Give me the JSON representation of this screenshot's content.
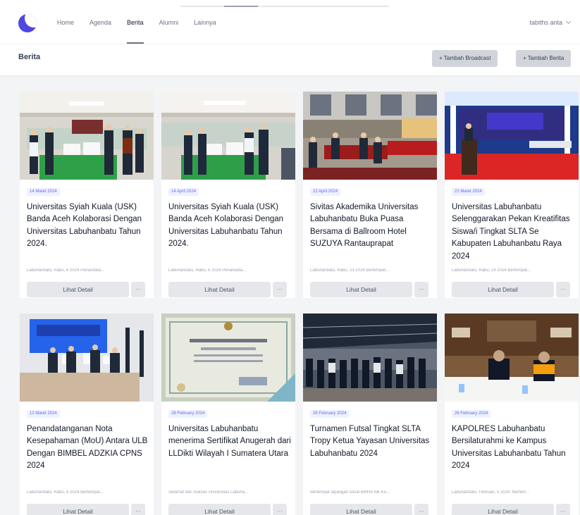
{
  "nav": {
    "items": [
      {
        "label": "Home",
        "active": false
      },
      {
        "label": "Agenda",
        "active": false
      },
      {
        "label": "Berita",
        "active": true
      },
      {
        "label": "Alumni",
        "active": false
      },
      {
        "label": "Lainnya",
        "active": false
      }
    ],
    "user": "tabiths anta"
  },
  "header": {
    "title": "Berita",
    "buttons": [
      "+ Tambah Broadcast",
      "+ Tambah Berita"
    ]
  },
  "colors": {
    "accent": "#4f46e5",
    "date_badge_bg": "#eef2ff",
    "date_badge_text": "#6366f1"
  },
  "cards": [
    {
      "date": "14 Maret 2024",
      "title": "Universitas Syiah Kuala (USK) Banda Aceh Kolaborasi Dengan Universitas Labuhanbatu Tahun 2024.",
      "excerpt": "Labuhanbatu, Rabu, 6 2024 Penandata...",
      "detail_label": "Lihat Detail",
      "more_label": "···"
    },
    {
      "date": "14 April 2024",
      "title": "Universitas Syiah Kuala (USK) Banda Aceh Kolaborasi Dengan Universitas Labuhanbatu Tahun 2024.",
      "excerpt": "Labuhanbatu, Rabu, 6 2024 Penandata...",
      "detail_label": "Lihat Detail",
      "more_label": "···"
    },
    {
      "date": "22 April 2024",
      "title": "Sivitas Akademika Universitas Labuhanbatu Buka Puasa Bersama di Ballroom Hotel SUZUYA Rantauprapat",
      "excerpt": "Labuhanbatu, Rabu, 23 2024 Bertempat...",
      "detail_label": "Lihat Detail",
      "more_label": "···"
    },
    {
      "date": "21 Maret 2024",
      "title": "Universitas Labuhanbatu Selenggarakan Pekan Kreatifitas Siswa/i Tingkat SLTA Se Kabupaten Labuhanbatu Raya 2024",
      "excerpt": "Labuhanbatu, Rabu, 19 2024 Bertempat...",
      "detail_label": "Lihat Detail",
      "more_label": "···"
    },
    {
      "date": "12 Maret 2024",
      "title": "Penandatanganan Nota Kesepahaman (MoU) Antara ULB Dengan BIMBEL ADZKIA CPNS 2024",
      "excerpt": "Labuhanbatu, Rabu, 6 2024 Bertempat...",
      "detail_label": "Lihat Detail",
      "more_label": "···"
    },
    {
      "date": "28 February 2024",
      "title": "Universitas Labuhanbatu menerima Sertifikat Anugerah dari LLDikti Wilayah I Sumatera Utara",
      "excerpt": "Selamat dan Sukses Universitas Labuha...",
      "detail_label": "Lihat Detail",
      "more_label": "···"
    },
    {
      "date": "26 February 2024",
      "title": "Turnamen Futsal Tingkat SLTA Tropy Ketua Yayasan Universitas Labuhanbatu 2024",
      "excerpt": "Bertempat lapangan futsal BMHA Nik Ko...",
      "detail_label": "Lihat Detail",
      "more_label": "···"
    },
    {
      "date": "26 February 2024",
      "title": "KAPOLRES Labuhanbatu Bersilaturahmi ke Kampus Universitas Labuhanbatu Tahun 2024",
      "excerpt": "Labuhanbatu, Februari, 5 2024. Bertem...",
      "detail_label": "Lihat Detail",
      "more_label": "···"
    }
  ]
}
